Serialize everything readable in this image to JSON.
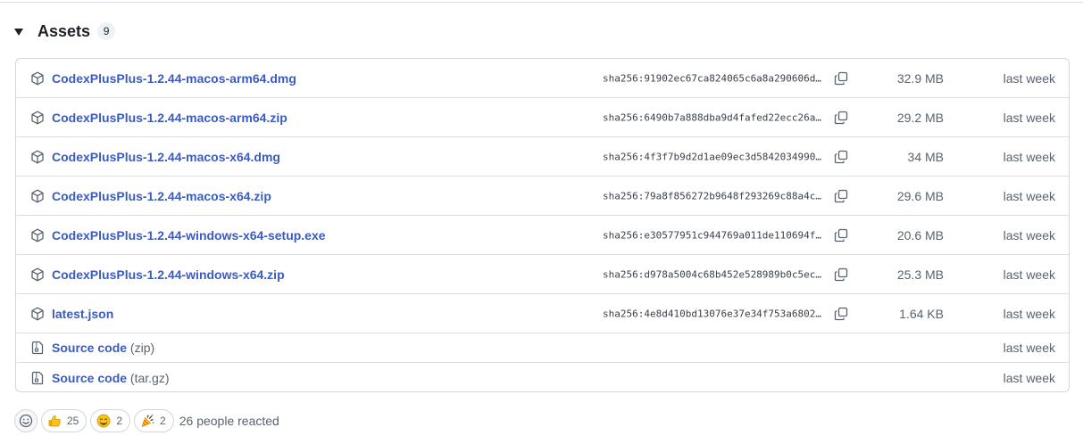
{
  "assets": {
    "title": "Assets",
    "count": "9",
    "files": [
      {
        "name": "CodexPlusPlus-1.2.44-macos-arm64.dmg",
        "sha": "sha256:91902ec67ca824065c6a8a290606d…",
        "size": "32.9 MB",
        "date": "last week"
      },
      {
        "name": "CodexPlusPlus-1.2.44-macos-arm64.zip",
        "sha": "sha256:6490b7a888dba9d4fafed22ecc26a…",
        "size": "29.2 MB",
        "date": "last week"
      },
      {
        "name": "CodexPlusPlus-1.2.44-macos-x64.dmg",
        "sha": "sha256:4f3f7b9d2d1ae09ec3d5842034990…",
        "size": "34 MB",
        "date": "last week"
      },
      {
        "name": "CodexPlusPlus-1.2.44-macos-x64.zip",
        "sha": "sha256:79a8f856272b9648f293269c88a4c…",
        "size": "29.6 MB",
        "date": "last week"
      },
      {
        "name": "CodexPlusPlus-1.2.44-windows-x64-setup.exe",
        "sha": "sha256:e30577951c944769a011de110694f…",
        "size": "20.6 MB",
        "date": "last week"
      },
      {
        "name": "CodexPlusPlus-1.2.44-windows-x64.zip",
        "sha": "sha256:d978a5004c68b452e528989b0c5ec…",
        "size": "25.3 MB",
        "date": "last week"
      },
      {
        "name": "latest.json",
        "sha": "sha256:4e8d410bd13076e37e34f753a6802…",
        "size": "1.64 KB",
        "date": "last week"
      }
    ],
    "source": [
      {
        "label": "Source code",
        "suffix": "(zip)",
        "date": "last week"
      },
      {
        "label": "Source code",
        "suffix": "(tar.gz)",
        "date": "last week"
      }
    ]
  },
  "icons": {
    "collapse": "triangle-down-icon",
    "file": "package-icon",
    "copy": "copy-icon",
    "source": "file-zip-icon",
    "add_reaction": "smiley-icon"
  },
  "reactions": {
    "items": [
      {
        "emoji": "thumbs-up",
        "count": "25"
      },
      {
        "emoji": "laugh",
        "count": "2"
      },
      {
        "emoji": "party",
        "count": "2"
      }
    ],
    "summary": "26 people reacted"
  },
  "colors": {
    "link": "#3b5cbd",
    "muted": "#59636e",
    "border": "#d0d7de"
  }
}
